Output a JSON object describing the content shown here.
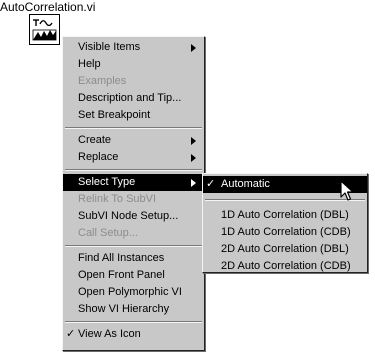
{
  "vi": {
    "name": "AutoCorrelation.vi",
    "icon": "autocorrelation-vi-icon"
  },
  "context_menu": {
    "visible_items": "Visible Items",
    "help": "Help",
    "examples": "Examples",
    "description_and_tip": "Description and Tip...",
    "set_breakpoint": "Set Breakpoint",
    "create": "Create",
    "replace": "Replace",
    "select_type": "Select Type",
    "relink_to_subvi": "Relink To SubVI",
    "subvi_node_setup": "SubVI Node Setup...",
    "call_setup": "Call Setup...",
    "find_all_instances": "Find All Instances",
    "open_front_panel": "Open Front Panel",
    "open_polymorphic_vi": "Open Polymorphic VI",
    "show_vi_hierarchy": "Show VI Hierarchy",
    "view_as_icon": "View As Icon",
    "check_mark": "✓"
  },
  "select_type_submenu": {
    "automatic": "Automatic",
    "check_mark": "✓",
    "options": [
      "1D Auto Correlation (DBL)",
      "1D Auto Correlation (CDB)",
      "2D Auto Correlation (DBL)",
      "2D Auto Correlation (CDB)"
    ]
  },
  "colors": {
    "menu_background": "#c8c8c8",
    "highlight_background": "#000000",
    "highlight_text": "#ffffff",
    "disabled_text": "#8c8c8c"
  }
}
